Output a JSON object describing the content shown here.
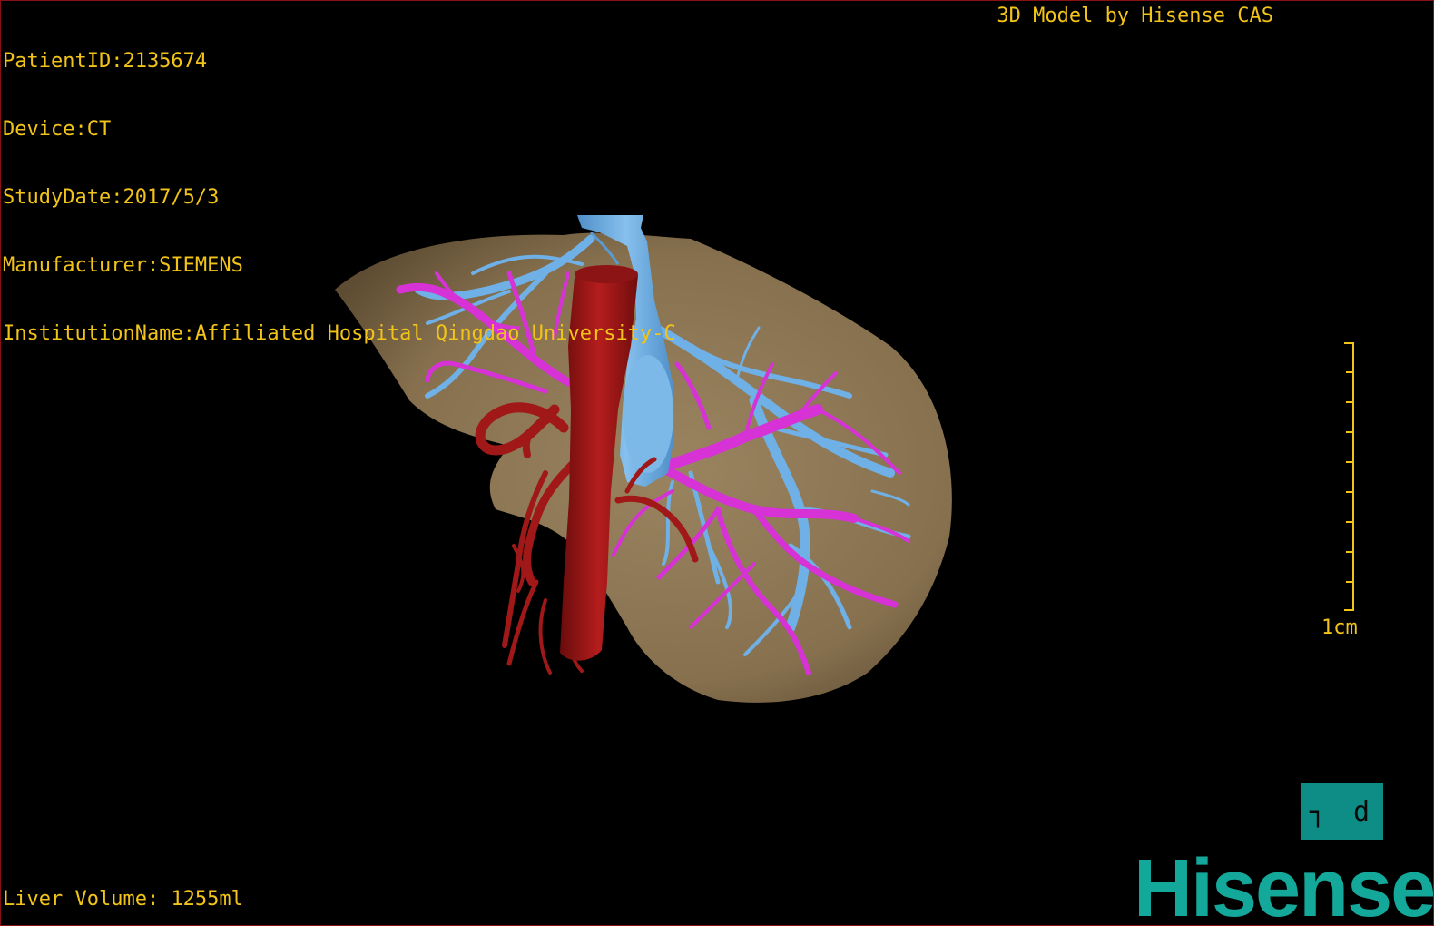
{
  "overlay": {
    "patient_id": "PatientID:2135674",
    "device": "Device:CT",
    "study_date": "StudyDate:2017/5/3",
    "manufacturer": "Manufacturer:SIEMENS",
    "institution": "InstitutionName:Affiliated Hospital Qingdao University-C",
    "model_credit": "3D Model by Hisense CAS",
    "liver_volume": "Liver Volume: 1255ml",
    "scale_label": "1cm"
  },
  "view_cube": {
    "label": "┐ d"
  },
  "brand": {
    "logo_text": "Hisense"
  },
  "colors": {
    "overlay_text": "#f2c318",
    "liver": "#8a7452",
    "artery_aorta": "#a01818",
    "portal_vein": "#d632d6",
    "hepatic_vein": "#6fb0e6",
    "brand": "#13a89a"
  }
}
